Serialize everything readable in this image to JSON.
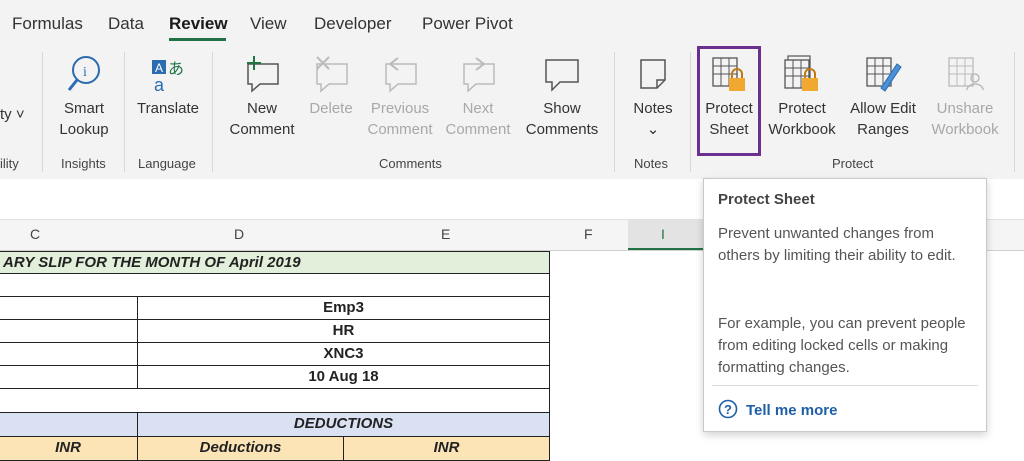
{
  "tabs": [
    "Formulas",
    "Data",
    "Review",
    "View",
    "Developer",
    "Power Pivot"
  ],
  "ribbon": {
    "accessibility": {
      "label": "ty ˅",
      "group": "ility"
    },
    "smart_lookup": {
      "line1": "Smart",
      "line2": "Lookup"
    },
    "insights_group": "Insights",
    "translate": "Translate",
    "language_group": "Language",
    "new_comment": {
      "line1": "New",
      "line2": "Comment"
    },
    "delete": "Delete",
    "previous_comment": {
      "line1": "Previous",
      "line2": "Comment"
    },
    "next_comment": {
      "line1": "Next",
      "line2": "Comment"
    },
    "show_comments": {
      "line1": "Show",
      "line2": "Comments"
    },
    "comments_group": "Comments",
    "notes": {
      "line1": "Notes",
      "line2": "⌄"
    },
    "notes_group": "Notes",
    "protect_sheet": {
      "line1": "Protect",
      "line2": "Sheet"
    },
    "protect_workbook": {
      "line1": "Protect",
      "line2": "Workbook"
    },
    "allow_edit_ranges": {
      "line1": "Allow Edit",
      "line2": "Ranges"
    },
    "unshare_workbook": {
      "line1": "Unshare",
      "line2": "Workbook"
    },
    "protect_group": "Protect"
  },
  "columns": [
    "C",
    "D",
    "E",
    "F",
    "I"
  ],
  "sheet": {
    "title": "ARY SLIP FOR THE MONTH OF April 2019",
    "emp": "Emp3",
    "dept": "HR",
    "code": "XNC3",
    "date": "10 Aug 18",
    "deductions_header": "DEDUCTIONS",
    "inr1": "INR",
    "deductions_col": "Deductions",
    "inr2": "INR"
  },
  "tooltip": {
    "title": "Protect Sheet",
    "para1": "Prevent unwanted changes from others by limiting their ability to edit.",
    "para2": "For example, you can prevent people from editing locked cells or making formatting changes.",
    "help": "Tell me more"
  }
}
